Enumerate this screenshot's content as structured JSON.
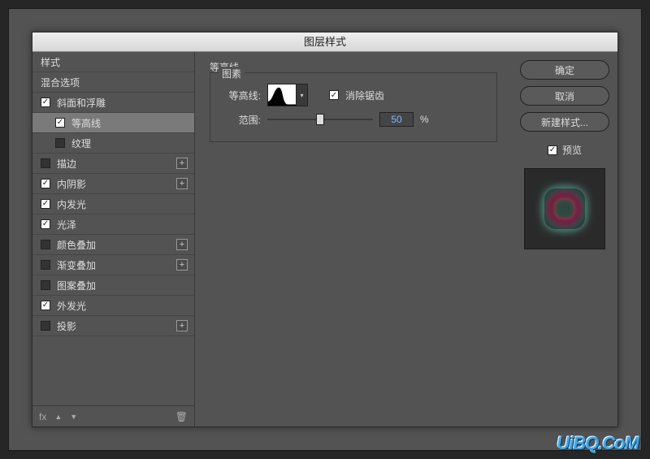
{
  "dialog": {
    "title": "图层样式"
  },
  "sidebar": {
    "header_style": "样式",
    "header_blend": "混合选项",
    "items": [
      {
        "label": "斜面和浮雕",
        "checked": true,
        "plus": false,
        "sub": false
      },
      {
        "label": "等高线",
        "checked": true,
        "plus": false,
        "sub": true,
        "selected": true
      },
      {
        "label": "纹理",
        "checked": false,
        "plus": false,
        "sub": true
      },
      {
        "label": "描边",
        "checked": false,
        "plus": true,
        "sub": false
      },
      {
        "label": "内阴影",
        "checked": true,
        "plus": true,
        "sub": false
      },
      {
        "label": "内发光",
        "checked": true,
        "plus": false,
        "sub": false
      },
      {
        "label": "光泽",
        "checked": true,
        "plus": false,
        "sub": false
      },
      {
        "label": "颜色叠加",
        "checked": false,
        "plus": true,
        "sub": false
      },
      {
        "label": "渐变叠加",
        "checked": false,
        "plus": true,
        "sub": false
      },
      {
        "label": "图案叠加",
        "checked": false,
        "plus": false,
        "sub": false
      },
      {
        "label": "外发光",
        "checked": true,
        "plus": false,
        "sub": false
      },
      {
        "label": "投影",
        "checked": false,
        "plus": true,
        "sub": false
      }
    ],
    "footer": {
      "fx": "fx",
      "up": "▲",
      "down": "▼",
      "trash": "🗑"
    }
  },
  "center": {
    "section_label": "等高线",
    "group_label": "图素",
    "contour_label": "等高线:",
    "antialias_label": "消除锯齿",
    "range_label": "范围:",
    "range_value": "50",
    "range_pct": "%"
  },
  "right": {
    "ok": "确定",
    "cancel": "取消",
    "new_style": "新建样式...",
    "preview": "预览"
  },
  "watermark": "UiBQ.CoM"
}
